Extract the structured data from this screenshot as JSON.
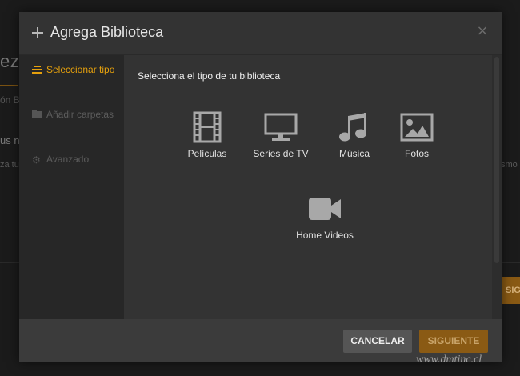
{
  "background": {
    "heading_fragment": "eza",
    "subheading_fragment": "ón B",
    "text_line1_fragment": "us n",
    "text_line2_fragment": "za tus",
    "right_fragment": "smo",
    "button_fragment": "SIG"
  },
  "modal": {
    "title": "Agrega Biblioteca",
    "close_symbol": "×",
    "sidebar": [
      {
        "label": "Seleccionar tipo",
        "icon": "lines-icon",
        "active": true
      },
      {
        "label": "Añadir carpetas",
        "icon": "folder-icon",
        "active": false
      },
      {
        "label": "Avanzado",
        "icon": "gear-icon",
        "active": false
      }
    ],
    "heading": "Selecciona el tipo de tu biblioteca",
    "types": [
      {
        "label": "Películas",
        "icon": "film-icon"
      },
      {
        "label": "Series de TV",
        "icon": "tv-icon"
      },
      {
        "label": "Música",
        "icon": "music-icon"
      },
      {
        "label": "Fotos",
        "icon": "photo-icon"
      },
      {
        "label": "Home Videos",
        "icon": "video-camera-icon"
      }
    ],
    "footer": {
      "cancel_label": "CANCELAR",
      "next_label": "SIGUIENTE"
    }
  },
  "watermark": "www.dmtinc.cl",
  "colors": {
    "accent": "#e5a00d",
    "modal_bg": "#333333",
    "sidebar_bg": "#272727",
    "next_button": "#8a5a14"
  }
}
